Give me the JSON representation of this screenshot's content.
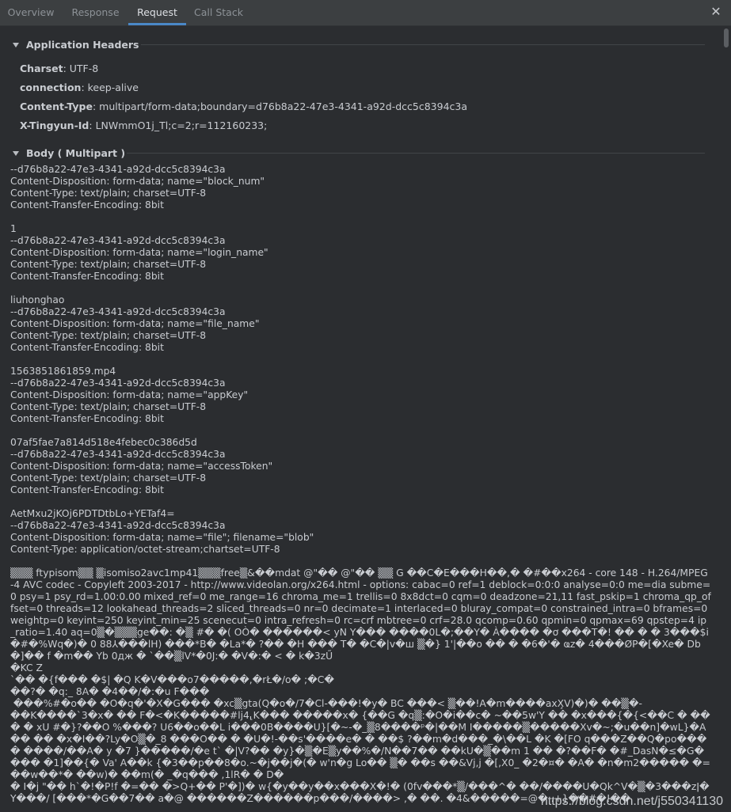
{
  "tabs": [
    {
      "label": "Overview",
      "active": false
    },
    {
      "label": "Response",
      "active": false
    },
    {
      "label": "Request",
      "active": true
    },
    {
      "label": "Call Stack",
      "active": false
    }
  ],
  "icons": {
    "close": "close-icon",
    "collapse": "triangle-down-icon"
  },
  "colors": {
    "background": "#2b2d30",
    "tabbar": "#3c3f41",
    "accent": "#4a88c7",
    "text": "#c9ccd1"
  },
  "sections": {
    "app_headers": {
      "title": "Application Headers",
      "rows": [
        {
          "key": "Charset",
          "value": " UTF-8"
        },
        {
          "key": "connection",
          "value": " keep-alive"
        },
        {
          "key": "Content-Type",
          "value": " multipart/form-data;boundary=d76b8a22-47e3-4341-a92d-dcc5c8394c3a"
        },
        {
          "key": "X-Tingyun-Id",
          "value": " LNWmmO1j_Tl;c=2;r=112160233;"
        }
      ]
    },
    "body": {
      "title": "Body ( Multipart )",
      "text": "--d76b8a22-47e3-4341-a92d-dcc5c8394c3a\nContent-Disposition: form-data; name=\"block_num\"\nContent-Type: text/plain; charset=UTF-8\nContent-Transfer-Encoding: 8bit\n\n1\n--d76b8a22-47e3-4341-a92d-dcc5c8394c3a\nContent-Disposition: form-data; name=\"login_name\"\nContent-Type: text/plain; charset=UTF-8\nContent-Transfer-Encoding: 8bit\n\nliuhonghao\n--d76b8a22-47e3-4341-a92d-dcc5c8394c3a\nContent-Disposition: form-data; name=\"file_name\"\nContent-Type: text/plain; charset=UTF-8\nContent-Transfer-Encoding: 8bit\n\n1563851861859.mp4\n--d76b8a22-47e3-4341-a92d-dcc5c8394c3a\nContent-Disposition: form-data; name=\"appKey\"\nContent-Type: text/plain; charset=UTF-8\nContent-Transfer-Encoding: 8bit\n\n07af5fae7a814d518e4febec0c386d5d\n--d76b8a22-47e3-4341-a92d-dcc5c8394c3a\nContent-Disposition: form-data; name=\"accessToken\"\nContent-Type: text/plain; charset=UTF-8\nContent-Transfer-Encoding: 8bit\n\nAetMxu2jKOj6PDTDtbLo+YETaf4=\n--d76b8a22-47e3-4341-a92d-dcc5c8394c3a\nContent-Disposition: form-data; name=\"file\"; filename=\"blob\"\nContent-Type: application/octet-stream;chartset=UTF-8",
      "binary": "▒▒▒ ftypisom▒▒ ▒isomiso2avc1mp41▒▒▒free▒&��mdat @\"�� @\"�� ▒▒ G ��C�E���H��,� �#��x264 - core 148 - H.264/MPEG-4 AVC codec - Copyleft 2003-2017 - http://www.videolan.org/x264.html - options: cabac=0 ref=1 deblock=0:0:0 analyse=0:0 me=dia subme=0 psy=1 psy_rd=1.00:0.00 mixed_ref=0 me_range=16 chroma_me=1 trellis=0 8x8dct=0 cqm=0 deadzone=21,11 fast_pskip=1 chroma_qp_offset=0 threads=12 lookahead_threads=2 sliced_threads=0 nr=0 decimate=1 interlaced=0 bluray_compat=0 constrained_intra=0 bframes=0 weightp=0 keyint=250 keyint_min=25 scenecut=0 intra_refresh=0 rc=crf mbtree=0 crf=28.0 qcomp=0.60 qpmin=0 qpmax=69 qpstep=4 ip_ratio=1.40 aq=0▒�▒▒▒ge��: �▒ #� �( OÒ� ������< yN Y��� ����0L�;��Y� À���� �ơ ���T�! �� � � 3���$i�#�%Wq�)� 0 88⅄���lH) ���*B� �La*� ?�� �H ��� T� �C�|v�ш ▒�} 1'|��o �� � �6�'� ҩz� 4���ØP�[�Xe� Db�]�� f �m�� Yb 0дж � `��▒lV*�0J:� �V�:� < � k�3zŰ\n�KC Z\n`�� �{f��� �$| �Q K�V���o7�����,�rŁ�/o� ;�C�\n��?� �q:_ 8A� �4��/�:�u F���\n ���%#�o�� �O�q�'�X�G��� �xc▒gta(Q�o�/7�Cl-���!�y� BC ���< ▒��!A�m����axX̧V)�)� ��▒�-\n��K����`3�x� �� F�<�K�����#lj4⸤K��� �����x� {��G �q▒:�O�i��c� ~��5w'Y �� �x���{�{<��C � ��� � xU #�}?��O %���? U6��o��L i���0B����U}[�~-�_▒8����ᵖ�|��M I�����▒�����Xv�~;�u��n]�wL}�A�� �� �x�I��?Ly�O▒�_8 ���O�� � �U�!-��s'����e� � ��$ ?��m�d���_�\\��L �K �[FO q���Z��Q�po���� ����/��A� y �7 }�����/�e t` �|V?�� �y}�▒�E▒y��%�/N��7�� ��kU�▒��m 1 �� �?��F� �#_DasN�≤�G���� �1]��{� Va' A��k {�3��p��8�o.~�j��j�(� w'n�g Lo�� ▒� ��s ��&Vj,j �[,X0_ �2�¤� �A� �n�m2����� �=��w��*� ��w)� ��m(� _�q��� ,1lR� � D�\n� I�j \"�� h`�!�P!f �=�� �>Q+�� P'�])� w{�y��y��x���X�!� (0fv���*▒/���^� ��/����U�Qk^V�▒�3���zǀ�Y���/ [���*�G��7�� a�@ ������Z������p���/����> ,� ��. �4&�����=@� .+}��#�!��"
    }
  },
  "watermark": "https://blog.csdn.net/j550341130"
}
